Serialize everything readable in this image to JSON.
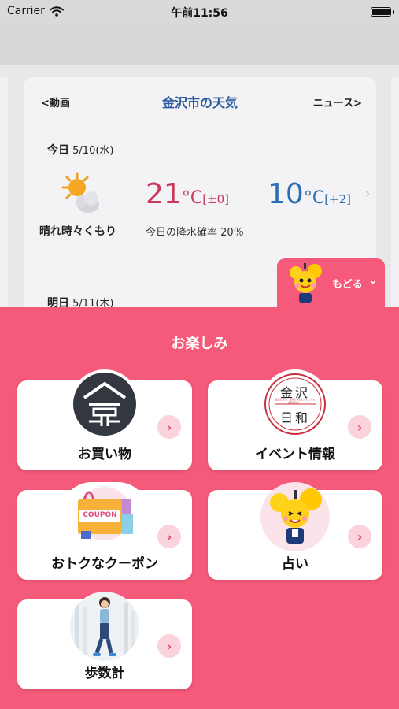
{
  "status_bar": {
    "carrier": "Carrier",
    "time": "午前11:56"
  },
  "weather": {
    "prev_link": "<動画",
    "title": "金沢市の天気",
    "next_link": "ニュース>",
    "today": {
      "day": "今日",
      "date": "5/10(水)",
      "condition": "晴れ時々くもり",
      "high": "21",
      "high_unit": "°C",
      "high_diff": "[±0]",
      "low": "10",
      "low_unit": "°C",
      "low_diff": "[+2]",
      "rain_label": "今日の降水確率",
      "rain_value": "20％"
    },
    "tomorrow": {
      "day": "明日",
      "date": "5/11(木)"
    }
  },
  "back_button": {
    "label": "もどる"
  },
  "panel": {
    "title": "お楽しみ",
    "tiles": [
      {
        "label": "お買い物"
      },
      {
        "label": "イベント情報"
      },
      {
        "label": "おトクなクーポン"
      },
      {
        "label": "占い"
      },
      {
        "label": "歩数計"
      }
    ]
  },
  "event_logo": {
    "line1": "金沢",
    "line2": "日和",
    "small": "金沢を愛し、金沢を愉しむ。とっておき情報サイト"
  },
  "coupon_text": "COUPON",
  "colors": {
    "panel": "#f65a7a",
    "title_blue": "#2c5aa0",
    "high_temp": "#c9395a",
    "low_temp": "#2c6cb2"
  },
  "icons": [
    "wifi-icon",
    "battery-icon",
    "weather-sun-cloud-icon",
    "chevron-right-icon",
    "chevron-down-icon",
    "mascot-icon",
    "shopping-logo-icon",
    "event-logo-icon",
    "coupon-bag-icon",
    "fortune-mascot-icon",
    "pedometer-runner-icon"
  ]
}
